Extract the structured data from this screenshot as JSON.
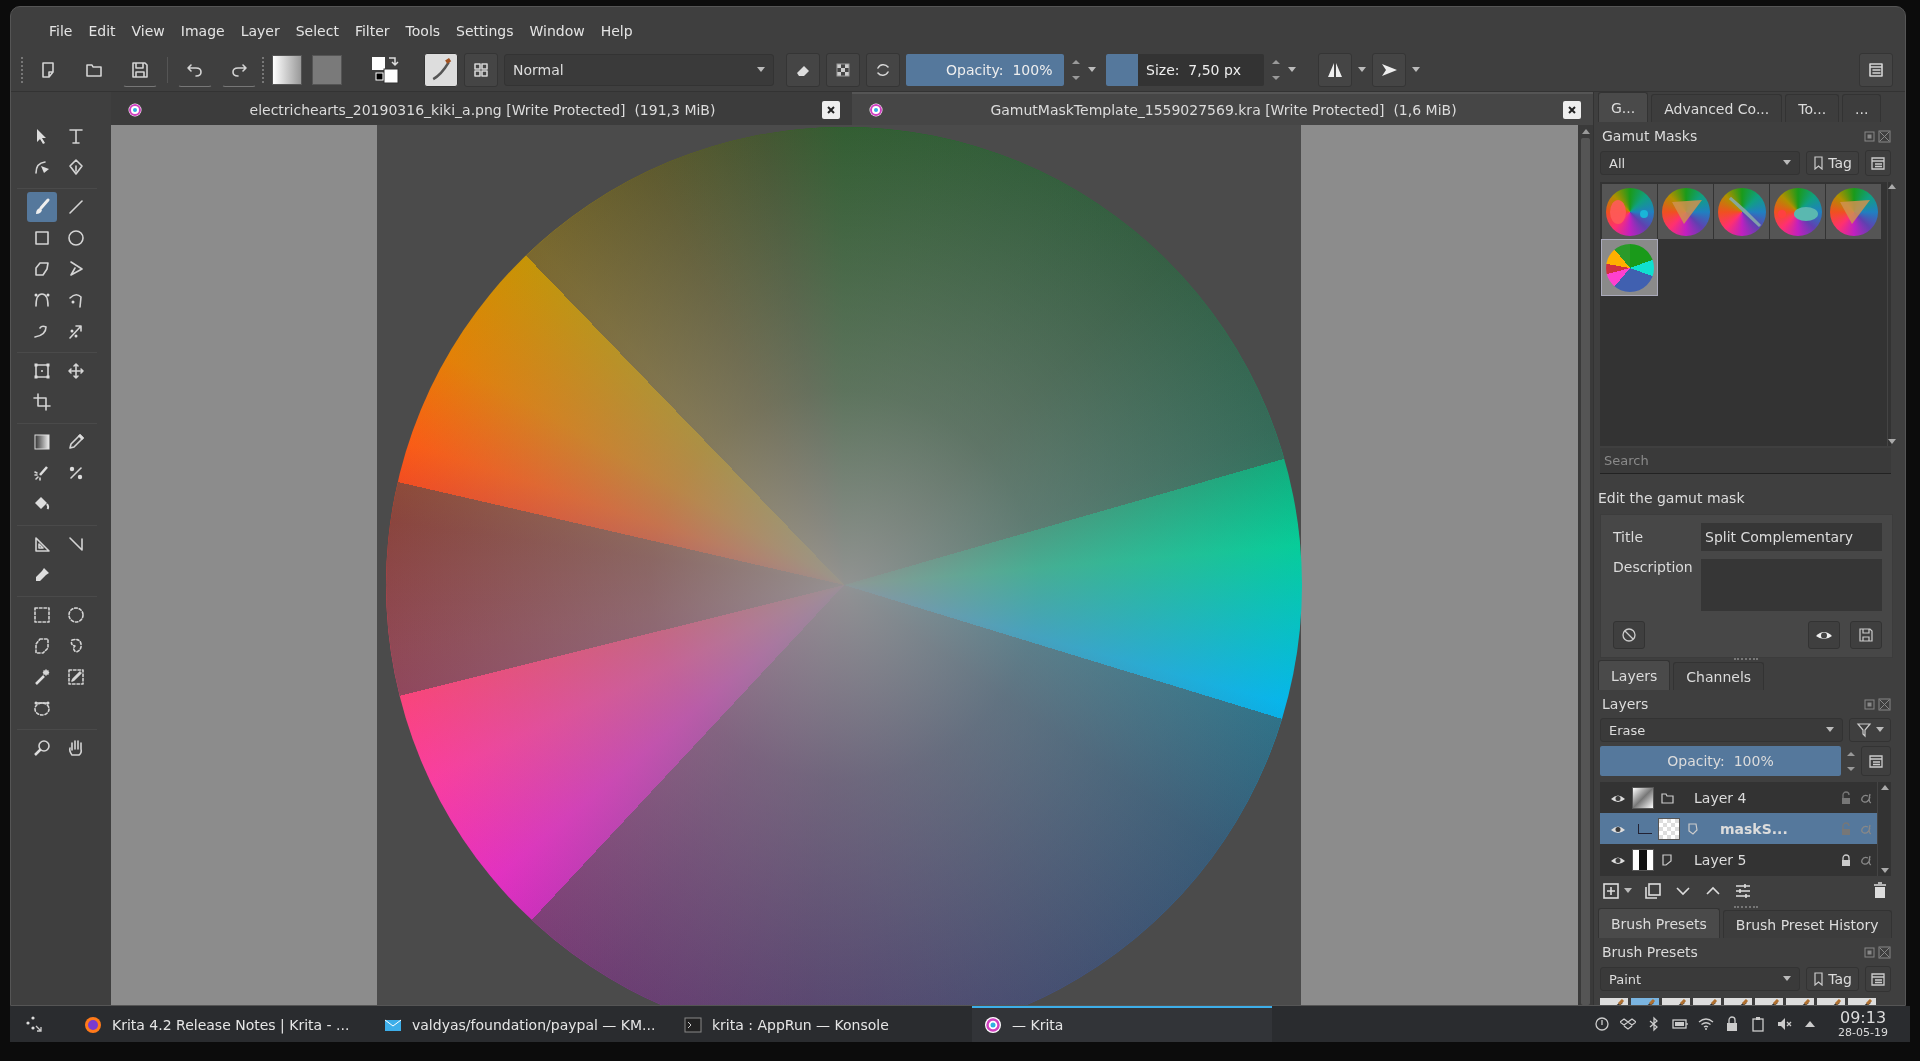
{
  "menu": [
    "File",
    "Edit",
    "View",
    "Image",
    "Layer",
    "Select",
    "Filter",
    "Tools",
    "Settings",
    "Window",
    "Help"
  ],
  "toolbar": {
    "blend_mode": "Normal",
    "opacity": {
      "label": "Opacity:  100%",
      "level": 1
    },
    "size": {
      "label": "Size:  7,50 px",
      "level": 0.2
    }
  },
  "documents": [
    {
      "title": "electrichearts_20190316_kiki_a.png [Write Protected]  (191,3 MiB)",
      "selected": false
    },
    {
      "title": "GamutMaskTemplate_1559027569.kra [Write Protected]  (1,6 MiB)",
      "selected": true
    }
  ],
  "tool_groups": [
    {
      "tools": [
        {
          "kind": "pointer",
          "selected": false
        },
        {
          "kind": "text",
          "selected": false
        },
        {
          "kind": "editshape",
          "selected": false
        },
        {
          "kind": "calligraphy",
          "selected": false
        }
      ]
    },
    {
      "tools": [
        {
          "kind": "brush",
          "selected": true
        },
        {
          "kind": "line",
          "selected": false
        },
        {
          "kind": "rectangle",
          "selected": false
        },
        {
          "kind": "ellipse",
          "selected": false
        },
        {
          "kind": "polygon",
          "selected": false
        },
        {
          "kind": "polyline",
          "selected": false
        },
        {
          "kind": "bezier",
          "selected": false
        },
        {
          "kind": "bezierpath",
          "selected": false
        },
        {
          "kind": "freehand",
          "selected": false
        },
        {
          "kind": "dynamic",
          "selected": false
        }
      ]
    },
    {
      "tools": [
        {
          "kind": "transform",
          "selected": false
        },
        {
          "kind": "move",
          "selected": false
        },
        {
          "kind": "crop",
          "selected": false
        }
      ]
    },
    {
      "tools": [
        {
          "kind": "gradient",
          "selected": false
        },
        {
          "kind": "picker",
          "selected": false
        },
        {
          "kind": "patch",
          "selected": false
        },
        {
          "kind": "multibrush",
          "selected": false
        },
        {
          "kind": "fill",
          "selected": false
        }
      ]
    },
    {
      "tools": [
        {
          "kind": "assistant",
          "selected": false
        },
        {
          "kind": "measure",
          "selected": false
        },
        {
          "kind": "reference",
          "selected": false
        }
      ]
    },
    {
      "tools": [
        {
          "kind": "rectselect",
          "selected": false
        },
        {
          "kind": "ellipseselect",
          "selected": false
        },
        {
          "kind": "polyselect",
          "selected": false
        },
        {
          "kind": "freeselect",
          "selected": false
        },
        {
          "kind": "wand",
          "selected": false
        },
        {
          "kind": "similarselect",
          "selected": false
        },
        {
          "kind": "bezierselect",
          "selected": false
        }
      ]
    },
    {
      "tools": [
        {
          "kind": "zoom",
          "selected": false
        },
        {
          "kind": "pan",
          "selected": false
        }
      ]
    }
  ],
  "gamut_masks": {
    "tabs": [
      {
        "label": "G...",
        "selected": true
      },
      {
        "label": "Advanced Co...",
        "selected": false
      },
      {
        "label": "To...",
        "selected": false
      },
      {
        "label": "...",
        "selected": false
      }
    ],
    "title": "Gamut Masks",
    "filter": "All",
    "tag": "Tag",
    "masks": [
      {
        "kind": "dots",
        "selected": false
      },
      {
        "kind": "triangle",
        "selected": false
      },
      {
        "kind": "diagonal",
        "selected": false
      },
      {
        "kind": "ellipse",
        "selected": false
      },
      {
        "kind": "triangle",
        "selected": false
      },
      {
        "kind": "wedges",
        "selected": true
      }
    ],
    "search": {
      "placeholder": "Search"
    },
    "editor": {
      "heading": "Edit the gamut mask",
      "title_label": "Title",
      "title_value": "Split Complementary",
      "description_label": "Description"
    }
  },
  "layers": {
    "tabs": [
      {
        "label": "Layers",
        "selected": true
      },
      {
        "label": "Channels",
        "selected": false
      }
    ],
    "title": "Layers",
    "blend_mode": "Erase",
    "opacity": {
      "label": "Opacity:  100%",
      "level": 1
    },
    "items": [
      {
        "name": "Layer 4",
        "kind": "group",
        "selected": false,
        "visible": true,
        "locked": false,
        "children": [
          {
            "name": "maskS...",
            "kind": "mask",
            "selected": true,
            "visible": true,
            "locked": false
          }
        ]
      },
      {
        "name": "Layer 5",
        "kind": "paint",
        "selected": false,
        "visible": true,
        "locked": true
      }
    ]
  },
  "brush_presets": {
    "tabs": [
      {
        "label": "Brush Presets",
        "selected": true
      },
      {
        "label": "Brush Preset History",
        "selected": false
      }
    ],
    "title": "Brush Presets",
    "filter": "Paint",
    "tag": "Tag",
    "presets": [
      {
        "selected": false
      },
      {
        "selected": true
      },
      {
        "selected": false
      },
      {
        "selected": false
      },
      {
        "selected": false
      },
      {
        "selected": false
      },
      {
        "selected": false
      },
      {
        "selected": false
      },
      {
        "selected": false
      }
    ]
  },
  "taskbar": {
    "tasks": [
      {
        "kind": "browser",
        "label": "Krita 4.2 Release Notes | Krita - ...",
        "selected": false
      },
      {
        "kind": "mail",
        "label": "valdyas/foundation/paypal — KM...",
        "selected": false
      },
      {
        "kind": "terminal",
        "label": "krita : AppRun — Konsole",
        "selected": false
      },
      {
        "kind": "krita",
        "label": "— Krita",
        "selected": true
      }
    ],
    "clock": {
      "time": "09:13",
      "date": "28-05-19"
    }
  }
}
